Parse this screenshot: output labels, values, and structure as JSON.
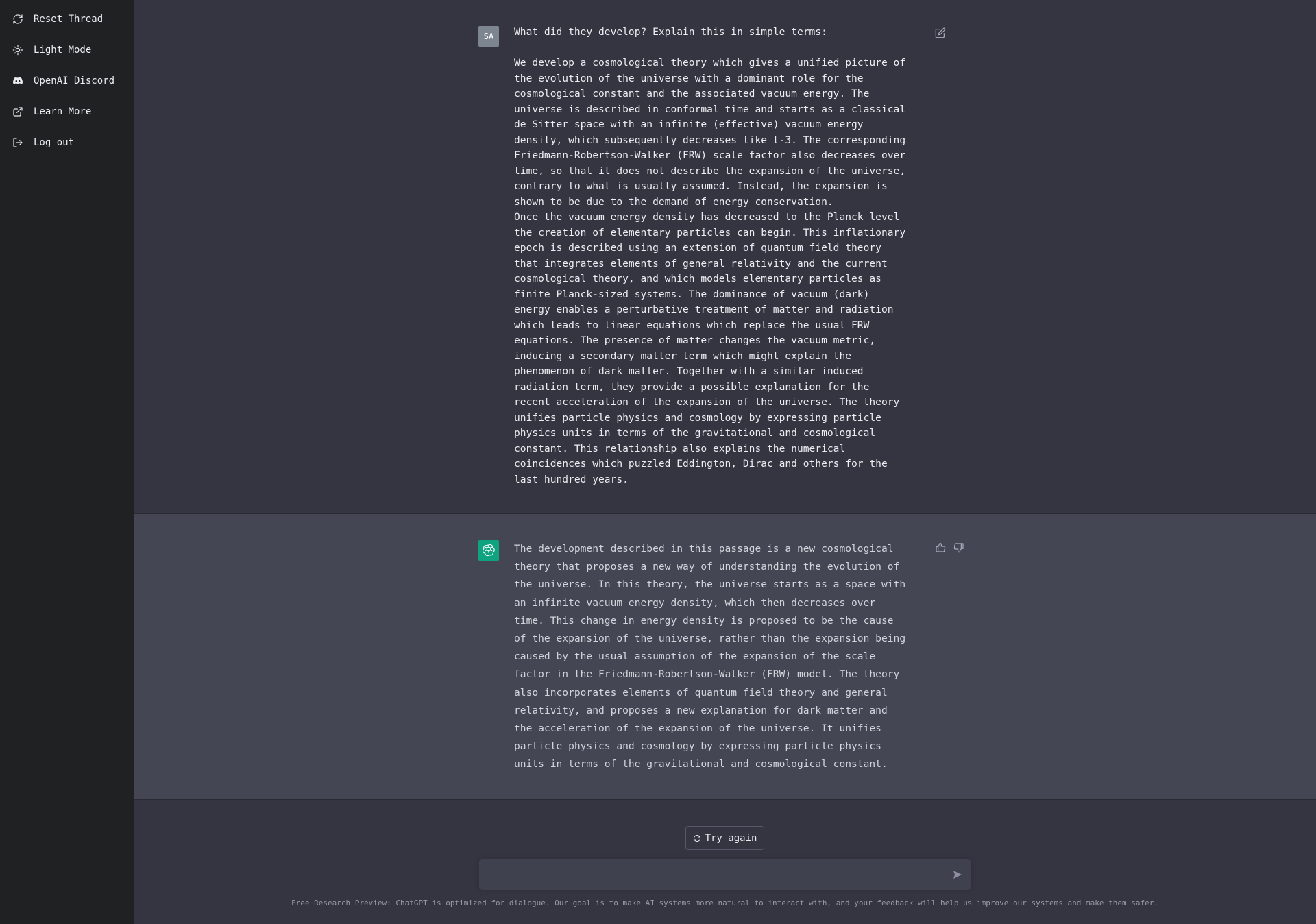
{
  "sidebar": {
    "items": [
      {
        "label": "Reset Thread",
        "icon": "refresh-icon"
      },
      {
        "label": "Light Mode",
        "icon": "sun-icon"
      },
      {
        "label": "OpenAI Discord",
        "icon": "discord-icon"
      },
      {
        "label": "Learn More",
        "icon": "external-link-icon"
      },
      {
        "label": "Log out",
        "icon": "logout-icon"
      }
    ]
  },
  "user_message": {
    "avatar": "SA",
    "text": "What did they develop? Explain this in simple terms:\n\nWe develop a cosmological theory which gives a unified picture of\nthe evolution of the universe with a dominant role for the\ncosmological constant and the associated vacuum energy. The\nuniverse is described in conformal time and starts as a classical\nde Sitter space with an infinite (effective) vacuum energy\ndensity, which subsequently decreases like t-3. The corresponding\nFriedmann-Robertson-Walker (FRW) scale factor also decreases over\ntime, so that it does not describe the expansion of the universe,\ncontrary to what is usually assumed. Instead, the expansion is\nshown to be due to the demand of energy conservation.\nOnce the vacuum energy density has decreased to the Planck level\nthe creation of elementary particles can begin. This inflationary\nepoch is described using an extension of quantum field theory\nthat integrates elements of general relativity and the current\ncosmological theory, and which models elementary particles as\nfinite Planck-sized systems. The dominance of vacuum (dark)\nenergy enables a perturbative treatment of matter and radiation\nwhich leads to linear equations which replace the usual FRW\nequations. The presence of matter changes the vacuum metric,\ninducing a secondary matter term which might explain the\nphenomenon of dark matter. Together with a similar induced\nradiation term, they provide a possible explanation for the\nrecent acceleration of the expansion of the universe. The theory\nunifies particle physics and cosmology by expressing particle\nphysics units in terms of the gravitational and cosmological\nconstant. This relationship also explains the numerical\ncoincidences which puzzled Eddington, Dirac and others for the\nlast hundred years."
  },
  "assistant_message": {
    "text": "The development described in this passage is a new cosmological\ntheory that proposes a new way of understanding the evolution of\nthe universe. In this theory, the universe starts as a space with\nan infinite vacuum energy density, which then decreases over\ntime. This change in energy density is proposed to be the cause\nof the expansion of the universe, rather than the expansion being\ncaused by the usual assumption of the expansion of the scale\nfactor in the Friedmann-Robertson-Walker (FRW) model. The theory\nalso incorporates elements of quantum field theory and general\nrelativity, and proposes a new explanation for dark matter and\nthe acceleration of the expansion of the universe. It unifies\nparticle physics and cosmology by expressing particle physics\nunits in terms of the gravitational and cosmological constant."
  },
  "controls": {
    "try_again_label": "Try again",
    "input_value": "",
    "input_placeholder": ""
  },
  "footer": {
    "text": "Free Research Preview: ChatGPT is optimized for dialogue. Our goal is to make AI systems more natural to interact with, and your feedback will help us improve our systems and make them safer."
  },
  "colors": {
    "sidebar_bg": "#202123",
    "main_bg": "#343541",
    "assistant_bg": "#444654",
    "assistant_avatar": "#10a37f",
    "user_avatar": "#7d8590"
  }
}
